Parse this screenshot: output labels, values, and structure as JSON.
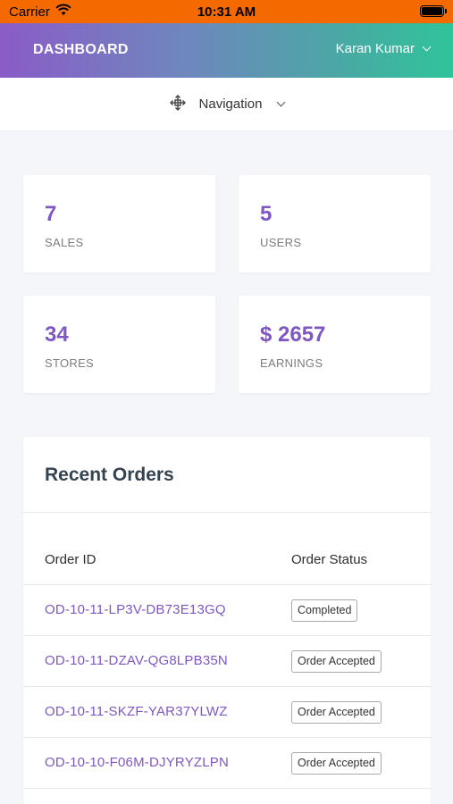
{
  "status_bar": {
    "carrier": "Carrier",
    "time": "10:31 AM"
  },
  "header": {
    "brand": "DASHBOARD",
    "user_name": "Karan Kumar"
  },
  "navigation": {
    "label": "Navigation"
  },
  "stats": [
    {
      "value": "7",
      "label": "SALES"
    },
    {
      "value": "5",
      "label": "USERS"
    },
    {
      "value": "34",
      "label": "STORES"
    },
    {
      "value": "$ 2657",
      "label": "EARNINGS"
    }
  ],
  "orders": {
    "title": "Recent Orders",
    "col_id": "Order ID",
    "col_status": "Order Status",
    "rows": [
      {
        "id": "OD-10-11-LP3V-DB73E13GQ",
        "status": "Completed"
      },
      {
        "id": "OD-10-11-DZAV-QG8LPB35N",
        "status": "Order Accepted"
      },
      {
        "id": "OD-10-11-SKZF-YAR37YLWZ",
        "status": "Order Accepted"
      },
      {
        "id": "OD-10-10-F06M-DJYRYZLPN",
        "status": "Order Accepted"
      }
    ]
  },
  "colors": {
    "accent": "#7e57c2",
    "status_bar": "#f56a00",
    "gradient_start": "#8a5cc7",
    "gradient_end": "#2fc49a"
  }
}
